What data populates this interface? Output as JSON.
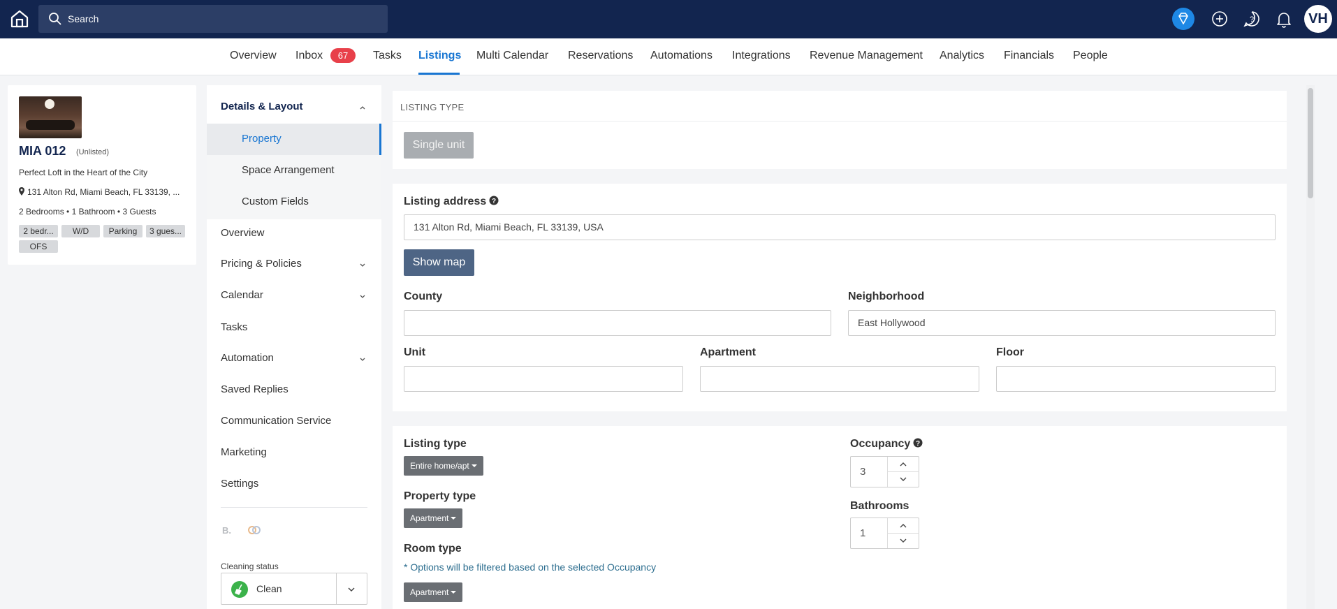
{
  "topbar": {
    "search_placeholder": "Search",
    "avatar_initials": "VH",
    "icons": [
      "home-icon",
      "search-icon",
      "diamond-icon",
      "plus-circle-icon",
      "chat-icon",
      "bell-icon"
    ],
    "accent": "#1e88e5",
    "bg": "#12254f"
  },
  "nav": {
    "items": [
      {
        "label": "Overview"
      },
      {
        "label": "Inbox",
        "badge": "67"
      },
      {
        "label": "Tasks"
      },
      {
        "label": "Listings",
        "active": true
      },
      {
        "label": "Multi Calendar"
      },
      {
        "label": "Reservations"
      },
      {
        "label": "Automations"
      },
      {
        "label": "Integrations"
      },
      {
        "label": "Revenue Management"
      },
      {
        "label": "Analytics"
      },
      {
        "label": "Financials"
      },
      {
        "label": "People"
      }
    ]
  },
  "listing_card": {
    "name": "MIA 012",
    "status": "(Unlisted)",
    "title": "Perfect Loft in the Heart of the City",
    "address": "131 Alton Rd, Miami Beach, FL 33139, ...",
    "specs": "2 Bedrooms  •  1 Bathroom  •  3 Guests",
    "tags": [
      "2 bedr...",
      "W/D",
      "Parking",
      "3 gues...",
      "OFS"
    ]
  },
  "sidemenu": {
    "section": "Details & Layout",
    "sub_items": [
      "Property",
      "Space Arrangement",
      "Custom Fields"
    ],
    "items": [
      "Overview",
      "Pricing & Policies",
      "Calendar",
      "Tasks",
      "Automation",
      "Saved Replies",
      "Communication Service",
      "Marketing",
      "Settings"
    ],
    "channel_icons": [
      "booking-icon",
      "airbnb-icon"
    ],
    "booking_glyph": "B.",
    "cleaning_label": "Cleaning status",
    "cleaning_value": "Clean"
  },
  "main": {
    "listing_type_header": "LISTING TYPE",
    "single_unit": "Single unit",
    "address_label": "Listing address",
    "address_value": "131 Alton Rd, Miami Beach, FL 33139, USA",
    "show_map": "Show map",
    "county_label": "County",
    "county_value": "",
    "neighborhood_label": "Neighborhood",
    "neighborhood_value": "East Hollywood",
    "unit_label": "Unit",
    "apartment_label": "Apartment",
    "floor_label": "Floor",
    "listing_type_label": "Listing type",
    "listing_type_value": "Entire home/apt",
    "property_type_label": "Property type",
    "property_type_value": "Apartment",
    "room_type_label": "Room type",
    "room_type_note": "* Options will be filtered based on the selected Occupancy",
    "room_type_value": "Apartment",
    "occupancy_label": "Occupancy",
    "occupancy_value": "3",
    "bathrooms_label": "Bathrooms",
    "bathrooms_value": "1"
  }
}
